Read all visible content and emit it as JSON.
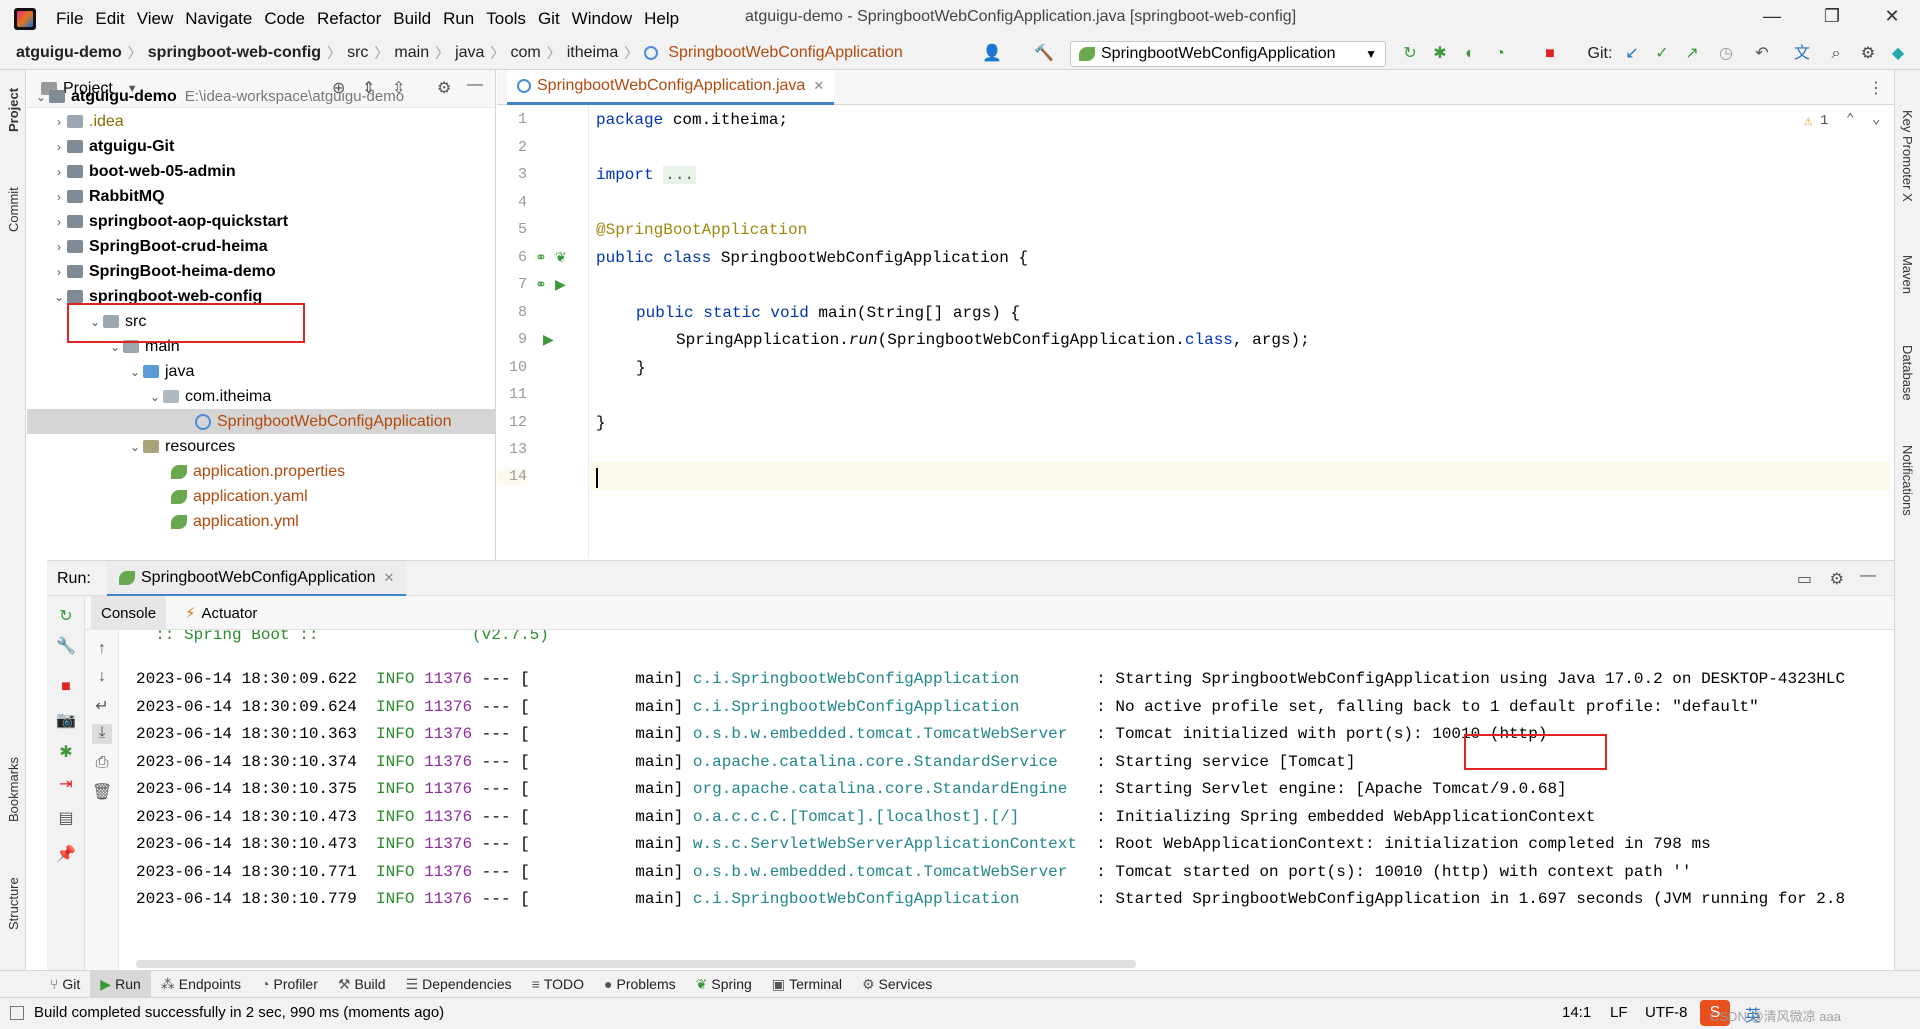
{
  "menu": {
    "items": [
      "File",
      "Edit",
      "View",
      "Navigate",
      "Code",
      "Refactor",
      "Build",
      "Run",
      "Tools",
      "Git",
      "Window",
      "Help"
    ],
    "window_title": "atguigu-demo - SpringbootWebConfigApplication.java [springboot-web-config]"
  },
  "breadcrumbs": [
    "atguigu-demo",
    "springboot-web-config",
    "src",
    "main",
    "java",
    "com",
    "itheima",
    "SpringbootWebConfigApplication"
  ],
  "toolbar": {
    "run_config": "SpringbootWebConfigApplication",
    "git_label": "Git:"
  },
  "side_tools": {
    "left": [
      "Project",
      "Commit",
      "Bookmarks",
      "Structure"
    ],
    "right": [
      "Key Promoter X",
      "Maven",
      "Database",
      "Notifications"
    ]
  },
  "project": {
    "title": "Project",
    "root": {
      "name": "atguigu-demo",
      "path": "E:\\idea-workspace\\atguigu-demo"
    },
    "items": [
      {
        "label": ".idea"
      },
      {
        "label": "atguigu-Git"
      },
      {
        "label": "boot-web-05-admin"
      },
      {
        "label": "RabbitMQ"
      },
      {
        "label": "springboot-aop-quickstart"
      },
      {
        "label": "SpringBoot-crud-heima"
      },
      {
        "label": "SpringBoot-heima-demo"
      },
      {
        "label": "springboot-web-config"
      },
      {
        "label": "src"
      },
      {
        "label": "main"
      },
      {
        "label": "java"
      },
      {
        "label": "com.itheima"
      },
      {
        "label": "SpringbootWebConfigApplication"
      },
      {
        "label": "resources"
      },
      {
        "label": "application.properties"
      },
      {
        "label": "application.yaml"
      },
      {
        "label": "application.yml"
      }
    ]
  },
  "editor": {
    "tab": "SpringbootWebConfigApplication.java",
    "warnings": "1",
    "line_numbers": [
      "1",
      "2",
      "3",
      "4",
      "5",
      "6",
      "7",
      "8",
      "9",
      "10",
      "11",
      "12",
      "13",
      "14"
    ],
    "code": {
      "l1_kw": "package",
      "l1_rest": " com.itheima;",
      "l3_kw": "import",
      "l3_fold": "...",
      "l6": "@SpringBootApplication",
      "l7_kw": "public class",
      "l7_rest": " SpringbootWebConfigApplication {",
      "l9_kw": "public static void",
      "l9_rest": " main(String[] args) {",
      "l10_a": "SpringApplication.",
      "l10_b": "run",
      "l10_c": "(SpringbootWebConfigApplication.",
      "l10_kw": "class",
      "l10_d": ", args);",
      "l11": "}",
      "l13": "}"
    }
  },
  "run": {
    "label": "Run:",
    "tab": "SpringbootWebConfigApplication",
    "subtabs": [
      "Console",
      "Actuator"
    ],
    "banner": "  :: Spring Boot ::                (v2.7.5)",
    "log": [
      {
        "ts": "2023-06-14 18:30:09.622",
        "level": "INFO",
        "pid": "11376",
        "thread": "--- [           main]",
        "logger": "c.i.SpringbootWebConfigApplication       ",
        "msg": ": Starting SpringbootWebConfigApplication using Java 17.0.2 on DESKTOP-4323HLC"
      },
      {
        "ts": "2023-06-14 18:30:09.624",
        "level": "INFO",
        "pid": "11376",
        "thread": "--- [           main]",
        "logger": "c.i.SpringbootWebConfigApplication       ",
        "msg": ": No active profile set, falling back to 1 default profile: \"default\""
      },
      {
        "ts": "2023-06-14 18:30:10.363",
        "level": "INFO",
        "pid": "11376",
        "thread": "--- [           main]",
        "logger": "o.s.b.w.embedded.tomcat.TomcatWebServer  ",
        "msg": ": Tomcat initialized with port(s): 10010 (http)"
      },
      {
        "ts": "2023-06-14 18:30:10.374",
        "level": "INFO",
        "pid": "11376",
        "thread": "--- [           main]",
        "logger": "o.apache.catalina.core.StandardService   ",
        "msg": ": Starting service [Tomcat]"
      },
      {
        "ts": "2023-06-14 18:30:10.375",
        "level": "INFO",
        "pid": "11376",
        "thread": "--- [           main]",
        "logger": "org.apache.catalina.core.StandardEngine  ",
        "msg": ": Starting Servlet engine: [Apache Tomcat/9.0.68]"
      },
      {
        "ts": "2023-06-14 18:30:10.473",
        "level": "INFO",
        "pid": "11376",
        "thread": "--- [           main]",
        "logger": "o.a.c.c.C.[Tomcat].[localhost].[/]       ",
        "msg": ": Initializing Spring embedded WebApplicationContext"
      },
      {
        "ts": "2023-06-14 18:30:10.473",
        "level": "INFO",
        "pid": "11376",
        "thread": "--- [           main]",
        "logger": "w.s.c.ServletWebServerApplicationContext ",
        "msg": ": Root WebApplicationContext: initialization completed in 798 ms"
      },
      {
        "ts": "2023-06-14 18:30:10.771",
        "level": "INFO",
        "pid": "11376",
        "thread": "--- [           main]",
        "logger": "o.s.b.w.embedded.tomcat.TomcatWebServer  ",
        "msg": ": Tomcat started on port(s): 10010 (http) with context path ''"
      },
      {
        "ts": "2023-06-14 18:30:10.779",
        "level": "INFO",
        "pid": "11376",
        "thread": "--- [           main]",
        "logger": "c.i.SpringbootWebConfigApplication       ",
        "msg": ": Started SpringbootWebConfigApplication in 1.697 seconds (JVM running for 2.8"
      }
    ]
  },
  "bottom_tabs": [
    "Git",
    "Run",
    "Endpoints",
    "Profiler",
    "Build",
    "Dependencies",
    "TODO",
    "Problems",
    "Spring",
    "Terminal",
    "Services"
  ],
  "status": {
    "message": "Build completed successfully in 2 sec, 990 ms (moments ago)",
    "position": "14:1",
    "line_sep": "LF",
    "encoding": "UTF-8",
    "ime": "英",
    "watermark": "CSDN @清风微凉 aaa"
  }
}
